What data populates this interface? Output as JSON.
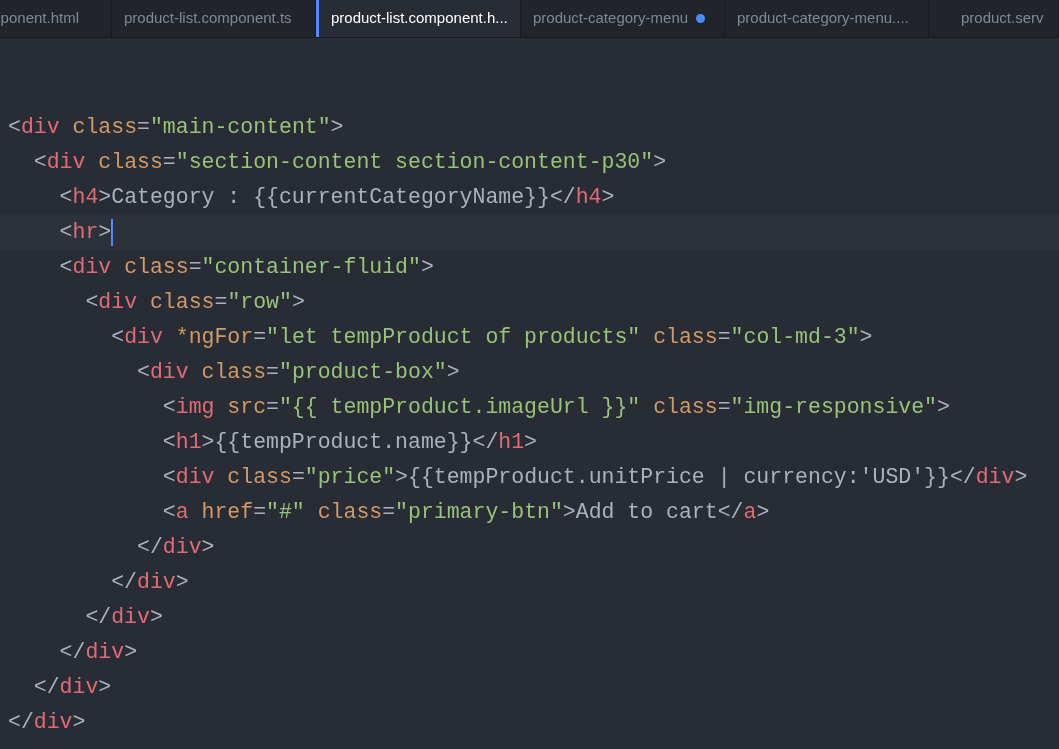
{
  "tabs": [
    {
      "label": "ponent.html",
      "selected": false,
      "modified": false
    },
    {
      "label": "product-list.component.ts",
      "selected": false,
      "modified": false
    },
    {
      "label": "product-list.component.h...",
      "selected": true,
      "modified": false
    },
    {
      "label": "product-category-menu",
      "selected": false,
      "modified": true
    },
    {
      "label": "product-category-menu....",
      "selected": false,
      "modified": false
    },
    {
      "label": "product.serv",
      "selected": false,
      "modified": false
    }
  ],
  "editor": {
    "lines": [
      {
        "current": false,
        "tokens": [
          {
            "kind": "punct",
            "text": "<"
          },
          {
            "kind": "tag",
            "text": "div"
          },
          {
            "kind": "attr",
            "text": " class"
          },
          {
            "kind": "punct",
            "text": "="
          },
          {
            "kind": "string",
            "text": "\"main-content\""
          },
          {
            "kind": "punct",
            "text": ">"
          }
        ]
      },
      {
        "current": false,
        "tokens": [
          {
            "kind": "punct",
            "text": "  <"
          },
          {
            "kind": "tag",
            "text": "div"
          },
          {
            "kind": "attr",
            "text": " class"
          },
          {
            "kind": "punct",
            "text": "="
          },
          {
            "kind": "string",
            "text": "\"section-content section-content-p30\""
          },
          {
            "kind": "punct",
            "text": ">"
          }
        ]
      },
      {
        "current": false,
        "tokens": [
          {
            "kind": "punct",
            "text": "    <"
          },
          {
            "kind": "tag",
            "text": "h4"
          },
          {
            "kind": "punct",
            "text": ">Category : {{currentCategoryName}}</"
          },
          {
            "kind": "tag",
            "text": "h4"
          },
          {
            "kind": "punct",
            "text": ">"
          }
        ]
      },
      {
        "current": true,
        "tokens": [
          {
            "kind": "punct",
            "text": "    <"
          },
          {
            "kind": "tag",
            "text": "hr"
          },
          {
            "kind": "punct",
            "text": ">"
          }
        ]
      },
      {
        "current": false,
        "tokens": [
          {
            "kind": "punct",
            "text": "    <"
          },
          {
            "kind": "tag",
            "text": "div"
          },
          {
            "kind": "attr",
            "text": " class"
          },
          {
            "kind": "punct",
            "text": "="
          },
          {
            "kind": "string",
            "text": "\"container-fluid\""
          },
          {
            "kind": "punct",
            "text": ">"
          }
        ]
      },
      {
        "current": false,
        "tokens": [
          {
            "kind": "punct",
            "text": "      <"
          },
          {
            "kind": "tag",
            "text": "div"
          },
          {
            "kind": "attr",
            "text": " class"
          },
          {
            "kind": "punct",
            "text": "="
          },
          {
            "kind": "string",
            "text": "\"row\""
          },
          {
            "kind": "punct",
            "text": ">"
          }
        ]
      },
      {
        "current": false,
        "tokens": [
          {
            "kind": "punct",
            "text": "        <"
          },
          {
            "kind": "tag",
            "text": "div"
          },
          {
            "kind": "attr",
            "text": " *ngFor"
          },
          {
            "kind": "punct",
            "text": "="
          },
          {
            "kind": "string",
            "text": "\"let tempProduct of products\""
          },
          {
            "kind": "attr",
            "text": " class"
          },
          {
            "kind": "punct",
            "text": "="
          },
          {
            "kind": "string",
            "text": "\"col-md-3\""
          },
          {
            "kind": "punct",
            "text": ">"
          }
        ]
      },
      {
        "current": false,
        "tokens": [
          {
            "kind": "punct",
            "text": "          <"
          },
          {
            "kind": "tag",
            "text": "div"
          },
          {
            "kind": "attr",
            "text": " class"
          },
          {
            "kind": "punct",
            "text": "="
          },
          {
            "kind": "string",
            "text": "\"product-box\""
          },
          {
            "kind": "punct",
            "text": ">"
          }
        ]
      },
      {
        "current": false,
        "tokens": [
          {
            "kind": "punct",
            "text": "            <"
          },
          {
            "kind": "tag",
            "text": "img"
          },
          {
            "kind": "attr",
            "text": " src"
          },
          {
            "kind": "punct",
            "text": "="
          },
          {
            "kind": "string",
            "text": "\"{{ tempProduct.imageUrl }}\""
          },
          {
            "kind": "attr",
            "text": " class"
          },
          {
            "kind": "punct",
            "text": "="
          },
          {
            "kind": "string",
            "text": "\"img-responsive\""
          },
          {
            "kind": "punct",
            "text": ">"
          }
        ]
      },
      {
        "current": false,
        "tokens": [
          {
            "kind": "punct",
            "text": "            <"
          },
          {
            "kind": "tag",
            "text": "h1"
          },
          {
            "kind": "punct",
            "text": ">{{tempProduct.name}}</"
          },
          {
            "kind": "tag",
            "text": "h1"
          },
          {
            "kind": "punct",
            "text": ">"
          }
        ]
      },
      {
        "current": false,
        "tokens": [
          {
            "kind": "punct",
            "text": "            <"
          },
          {
            "kind": "tag",
            "text": "div"
          },
          {
            "kind": "attr",
            "text": " class"
          },
          {
            "kind": "punct",
            "text": "="
          },
          {
            "kind": "string",
            "text": "\"price\""
          },
          {
            "kind": "punct",
            "text": ">{{tempProduct.unitPrice | currency:'USD'}}</"
          },
          {
            "kind": "tag",
            "text": "div"
          },
          {
            "kind": "punct",
            "text": ">"
          }
        ]
      },
      {
        "current": false,
        "tokens": [
          {
            "kind": "punct",
            "text": "            <"
          },
          {
            "kind": "tag",
            "text": "a"
          },
          {
            "kind": "attr",
            "text": " href"
          },
          {
            "kind": "punct",
            "text": "="
          },
          {
            "kind": "string",
            "text": "\"#\""
          },
          {
            "kind": "attr",
            "text": " class"
          },
          {
            "kind": "punct",
            "text": "="
          },
          {
            "kind": "string",
            "text": "\"primary-btn\""
          },
          {
            "kind": "punct",
            "text": ">Add to cart</"
          },
          {
            "kind": "tag",
            "text": "a"
          },
          {
            "kind": "punct",
            "text": ">"
          }
        ]
      },
      {
        "current": false,
        "tokens": [
          {
            "kind": "punct",
            "text": "          </"
          },
          {
            "kind": "tag",
            "text": "div"
          },
          {
            "kind": "punct",
            "text": ">"
          }
        ]
      },
      {
        "current": false,
        "tokens": [
          {
            "kind": "punct",
            "text": "        </"
          },
          {
            "kind": "tag",
            "text": "div"
          },
          {
            "kind": "punct",
            "text": ">"
          }
        ]
      },
      {
        "current": false,
        "tokens": [
          {
            "kind": "punct",
            "text": "      </"
          },
          {
            "kind": "tag",
            "text": "div"
          },
          {
            "kind": "punct",
            "text": ">"
          }
        ]
      },
      {
        "current": false,
        "tokens": [
          {
            "kind": "punct",
            "text": "    </"
          },
          {
            "kind": "tag",
            "text": "div"
          },
          {
            "kind": "punct",
            "text": ">"
          }
        ]
      },
      {
        "current": false,
        "tokens": [
          {
            "kind": "punct",
            "text": "  </"
          },
          {
            "kind": "tag",
            "text": "div"
          },
          {
            "kind": "punct",
            "text": ">"
          }
        ]
      },
      {
        "current": false,
        "tokens": [
          {
            "kind": "punct",
            "text": "</"
          },
          {
            "kind": "tag",
            "text": "div"
          },
          {
            "kind": "punct",
            "text": ">"
          }
        ]
      }
    ]
  }
}
